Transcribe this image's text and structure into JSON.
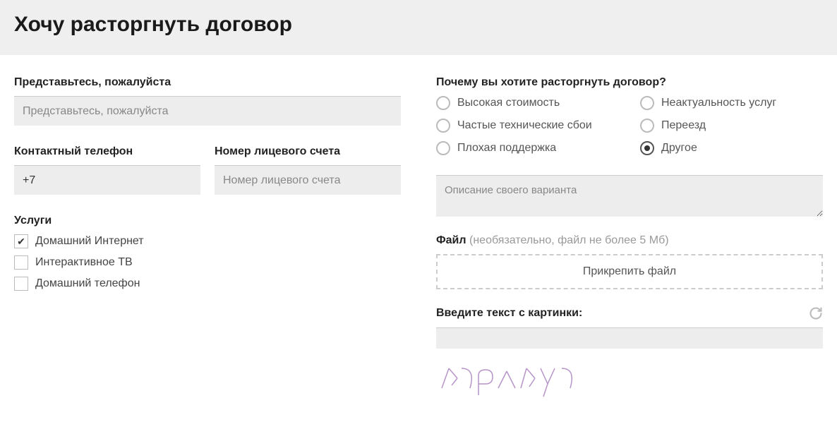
{
  "header": {
    "title": "Хочу расторгнуть договор"
  },
  "left": {
    "name_label": "Представьтесь, пожалуйста",
    "name_placeholder": "Представьтесь, пожалуйста",
    "phone_label": "Контактный телефон",
    "phone_value": "+7",
    "account_label": "Номер лицевого счета",
    "account_placeholder": "Номер лицевого счета",
    "services_label": "Услуги",
    "services": [
      {
        "label": "Домашний Интернет",
        "checked": true
      },
      {
        "label": "Интерактивное ТВ",
        "checked": false
      },
      {
        "label": "Домашний телефон",
        "checked": false
      }
    ]
  },
  "right": {
    "reason_label": "Почему вы хотите расторгнуть договор?",
    "reasons": [
      {
        "label": "Высокая стоимость",
        "selected": false
      },
      {
        "label": "Неактуальность услуг",
        "selected": false
      },
      {
        "label": "Частые технические сбои",
        "selected": false
      },
      {
        "label": "Переезд",
        "selected": false
      },
      {
        "label": "Плохая поддержка",
        "selected": false
      },
      {
        "label": "Другое",
        "selected": true
      }
    ],
    "desc_placeholder": "Описание своего варианта",
    "file_label": "Файл",
    "file_hint": " (необязательно, файл не более 5 Мб)",
    "file_button": "Прикрепить файл",
    "captcha_label": "Введите текст с картинки:",
    "captcha_text": "k7pxky7"
  }
}
